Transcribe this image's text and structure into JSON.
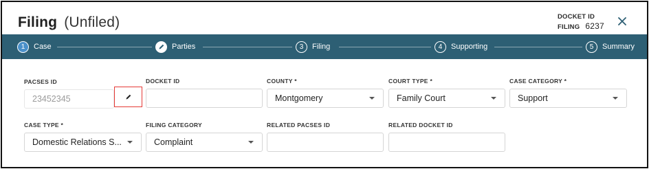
{
  "header": {
    "title": "Filing",
    "subtitle": "(Unfiled)",
    "docket_id_label": "DOCKET ID",
    "filing_label": "FILING",
    "filing_number": "6237"
  },
  "stepper": {
    "steps": [
      {
        "number": "1",
        "label": "Case",
        "state": "active"
      },
      {
        "number": "",
        "label": "Parties",
        "state": "done"
      },
      {
        "number": "3",
        "label": "Filing",
        "state": "pending"
      },
      {
        "number": "4",
        "label": "Supporting",
        "state": "pending"
      },
      {
        "number": "5",
        "label": "Summary",
        "state": "pending"
      }
    ]
  },
  "form": {
    "pacses_id": {
      "label": "PACSES ID",
      "value": "23452345"
    },
    "docket_id": {
      "label": "DOCKET ID",
      "value": ""
    },
    "county": {
      "label": "COUNTY *",
      "value": "Montgomery"
    },
    "court_type": {
      "label": "COURT TYPE *",
      "value": "Family Court"
    },
    "case_category": {
      "label": "CASE CATEGORY *",
      "value": "Support"
    },
    "case_type": {
      "label": "CASE TYPE *",
      "value": "Domestic Relations S..."
    },
    "filing_category": {
      "label": "FILING CATEGORY",
      "value": "Complaint"
    },
    "related_pacses_id": {
      "label": "RELATED PACSES ID",
      "value": ""
    },
    "related_docket_id": {
      "label": "RELATED DOCKET ID",
      "value": ""
    }
  },
  "colors": {
    "stepper_bg": "#2d5f74",
    "active_step": "#4a90c9",
    "highlight_border": "#e53935"
  },
  "icons": {
    "close": "close-icon",
    "edit": "pencil-icon",
    "done_step": "pencil-icon",
    "dropdown": "chevron-down-icon"
  }
}
